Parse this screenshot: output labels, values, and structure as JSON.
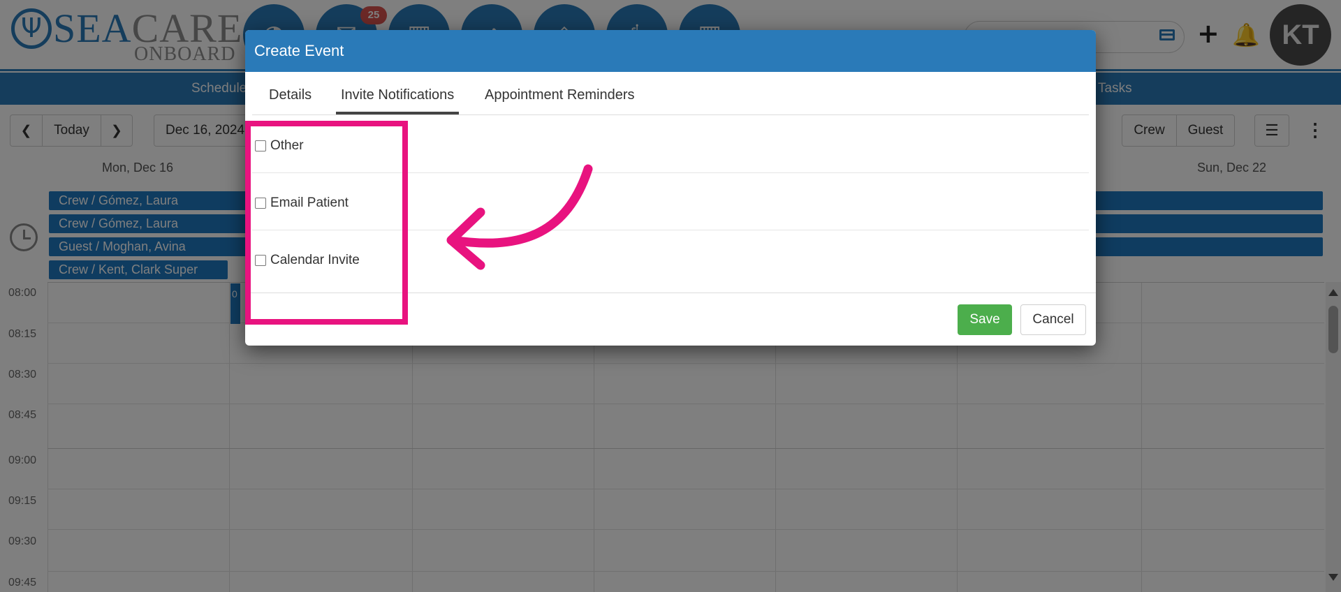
{
  "brand": {
    "logo_sea_blue": "SEA",
    "logo_sea_grey": "CARE",
    "logo_onboard": "ONBOARD",
    "accent_color": "#2a7ab8"
  },
  "header": {
    "nav_icons": [
      "dashboard-icon",
      "messages-icon",
      "calendar-icon",
      "transfer-icon",
      "inventory-icon",
      "medical-icon",
      "reports-icon"
    ],
    "badge_count": "25",
    "avatar_initials": "KT"
  },
  "subnav": {
    "schedule_label": "Schedule",
    "tasks_label": "Tasks"
  },
  "toolbar": {
    "today_label": "Today",
    "date_value": "Dec 16, 2024",
    "crew_label": "Crew",
    "guest_label": "Guest"
  },
  "calendar": {
    "day_first": "Mon, Dec 16",
    "day_last": "Sun, Dec 22",
    "allday_events": [
      "Crew / Gómez, Laura",
      "Crew / Gómez, Laura",
      "Guest / Moghan, Avina",
      "Crew / Kent, Clark Super"
    ],
    "mini_event_label": "0",
    "times": [
      "08:00",
      "08:15",
      "08:30",
      "08:45",
      "09:00",
      "09:15",
      "09:30",
      "09:45"
    ]
  },
  "modal": {
    "title": "Create Event",
    "tabs": [
      "Details",
      "Invite Notifications",
      "Appointment Reminders"
    ],
    "active_tab": "Invite Notifications",
    "options": [
      {
        "label": "Other",
        "checked": false
      },
      {
        "label": "Email Patient",
        "checked": false
      },
      {
        "label": "Calendar Invite",
        "checked": false
      }
    ],
    "save_label": "Save",
    "cancel_label": "Cancel",
    "save_color": "#4cae4c"
  },
  "annotation": {
    "highlight_color": "#e8137f"
  }
}
